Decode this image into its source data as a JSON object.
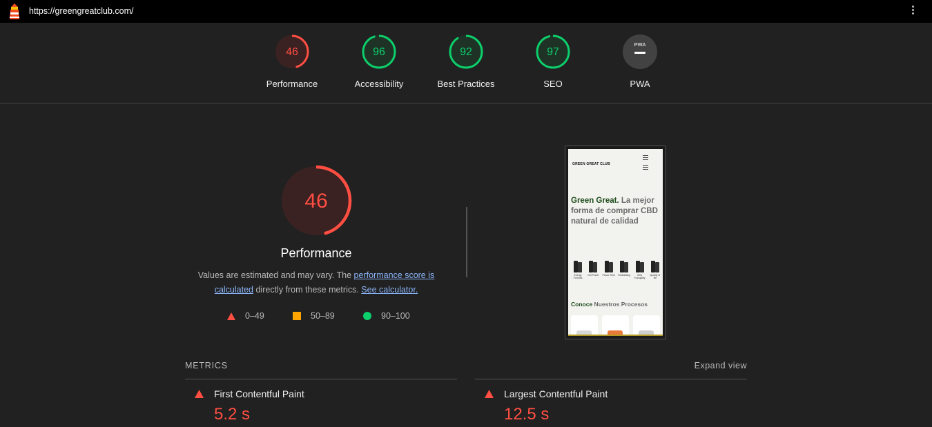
{
  "topbar": {
    "url": "https://greengreatclub.com/"
  },
  "colors": {
    "fail": "#ff4e42",
    "average": "#ffa400",
    "pass": "#0cce6b",
    "background": "#212121"
  },
  "gauges": [
    {
      "label": "Performance",
      "score": "46",
      "fraction": 0.46,
      "status": "fail"
    },
    {
      "label": "Accessibility",
      "score": "96",
      "fraction": 0.96,
      "status": "pass"
    },
    {
      "label": "Best Practices",
      "score": "92",
      "fraction": 0.92,
      "status": "pass"
    },
    {
      "label": "SEO",
      "score": "97",
      "fraction": 0.97,
      "status": "pass"
    },
    {
      "label": "PWA",
      "score": "",
      "status": "pwa"
    }
  ],
  "pwa_badge": "PWA",
  "performance": {
    "score": "46",
    "fraction": 0.46,
    "title": "Performance",
    "desc_prefix": "Values are estimated and may vary. The ",
    "link_score": "performance score is calculated",
    "desc_middle": " directly from these metrics. ",
    "link_calculator": "See calculator.",
    "legend": [
      {
        "range": "0–49",
        "shape": "triangle"
      },
      {
        "range": "50–89",
        "shape": "square"
      },
      {
        "range": "90–100",
        "shape": "circle"
      }
    ]
  },
  "screenshot": {
    "brand": "GREEN GREAT CLUB",
    "headline_green": "Green Great.",
    "headline_rest": " La mejor forma de comprar CBD natural de calidad",
    "products": [
      {
        "caption": "Energy Formula"
      },
      {
        "caption": "Girl Power"
      },
      {
        "caption": "Peace Time"
      },
      {
        "caption": "Revitalising"
      },
      {
        "caption": "Mild Tranquility"
      },
      {
        "caption": "Quality of life"
      }
    ],
    "section_green": "Conoce",
    "section_rest": " Nuestros Procesos"
  },
  "metrics": {
    "heading": "METRICS",
    "expand": "Expand view",
    "items": [
      {
        "name": "First Contentful Paint",
        "value": "5.2 s"
      },
      {
        "name": "Largest Contentful Paint",
        "value": "12.5 s"
      }
    ]
  }
}
